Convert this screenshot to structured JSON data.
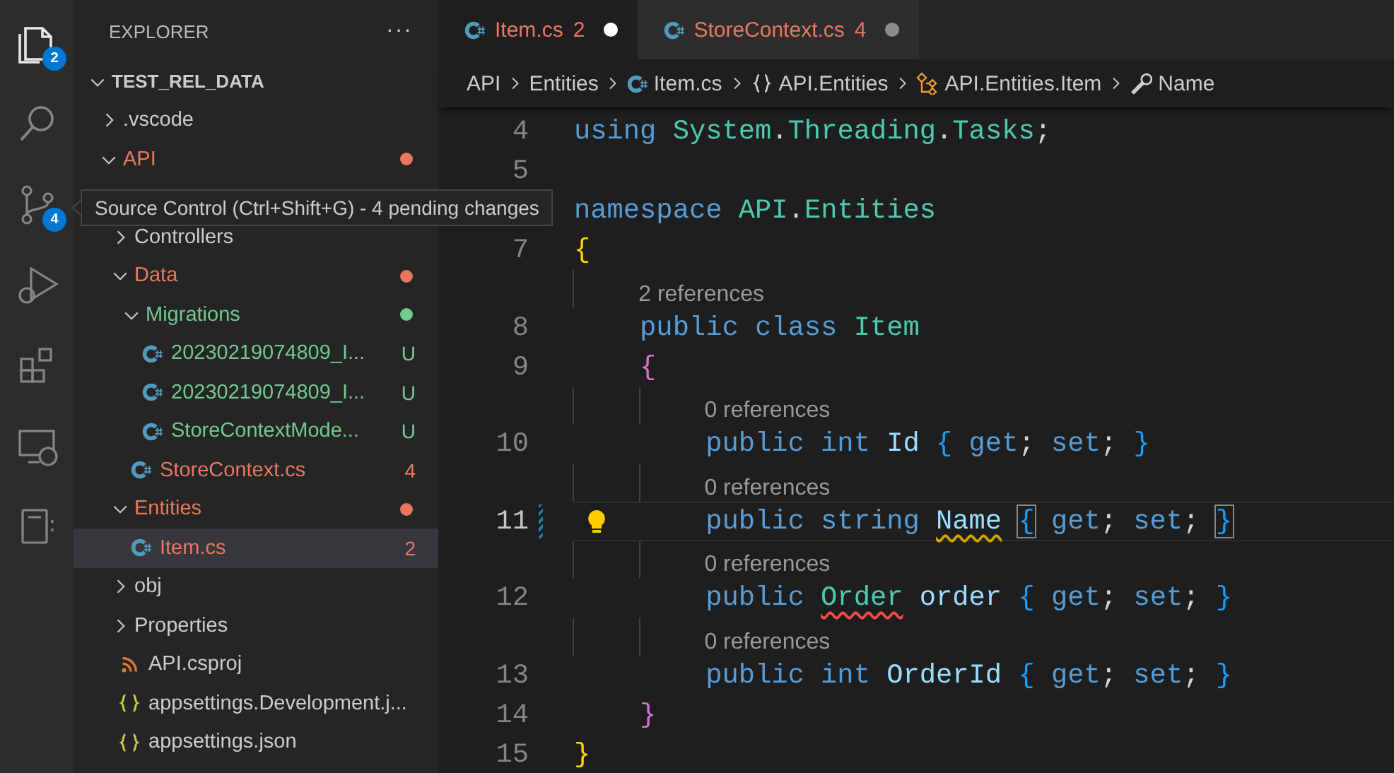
{
  "activity_bar": [
    {
      "selected": true,
      "badge": "2"
    },
    {
      "selected": false
    },
    {
      "selected": false,
      "badge": "4"
    },
    {
      "selected": false
    },
    {
      "selected": false
    },
    {
      "selected": false
    },
    {
      "selected": false
    }
  ],
  "tooltip": {
    "text": "Source Control (Ctrl+Shift+G) - 4 pending changes"
  },
  "sidebar": {
    "title": "EXPLORER",
    "more": "···",
    "tree": [
      {
        "label": "TEST_REL_DATA",
        "kind": "root",
        "expanded": true,
        "selected": false,
        "color": "#cccccc",
        "children": [
          {
            "label": ".vscode",
            "kind": "folder",
            "expanded": false,
            "selected": false,
            "color": "#cccccc"
          },
          {
            "label": "API",
            "kind": "folder",
            "expanded": true,
            "selected": false,
            "color": "#e8775f",
            "dot": true,
            "children": [
              {
                "kind": "covered"
              },
              {
                "label": "Controllers",
                "kind": "folder",
                "expanded": false,
                "selected": false,
                "color": "#cccccc"
              },
              {
                "label": "Data",
                "kind": "folder",
                "expanded": true,
                "selected": false,
                "color": "#e8775f",
                "dot": true,
                "children": [
                  {
                    "label": "Migrations",
                    "kind": "folder",
                    "expanded": true,
                    "selected": false,
                    "color": "#73c991",
                    "dot": true,
                    "children": [
                      {
                        "label": "20230219074809_I...",
                        "kind": "csharp-file",
                        "color": "#73c991",
                        "badge": "U",
                        "selected": false
                      },
                      {
                        "label": "20230219074809_I...",
                        "kind": "csharp-file",
                        "color": "#73c991",
                        "badge": "U",
                        "selected": false
                      },
                      {
                        "label": "StoreContextMode...",
                        "kind": "csharp-file",
                        "color": "#73c991",
                        "badge": "U",
                        "selected": false
                      }
                    ]
                  },
                  {
                    "label": "StoreContext.cs",
                    "kind": "csharp-file",
                    "color": "#e8775f",
                    "badge": "4",
                    "selected": false
                  }
                ]
              },
              {
                "label": "Entities",
                "kind": "folder",
                "expanded": true,
                "selected": false,
                "color": "#e8775f",
                "dot": true,
                "children": [
                  {
                    "label": "Item.cs",
                    "kind": "csharp-file",
                    "color": "#e8775f",
                    "badge": "2",
                    "selected": true
                  }
                ]
              },
              {
                "label": "obj",
                "kind": "folder",
                "expanded": false,
                "selected": false,
                "color": "#cccccc"
              },
              {
                "label": "Properties",
                "kind": "folder",
                "expanded": false,
                "selected": false,
                "color": "#cccccc"
              },
              {
                "label": "API.csproj",
                "kind": "rss-file",
                "selected": false,
                "color": "#cccccc"
              },
              {
                "label": "appsettings.Development.j...",
                "kind": "json-file",
                "selected": false,
                "color": "#cccccc"
              },
              {
                "label": "appsettings.json",
                "kind": "json-file",
                "selected": false,
                "color": "#cccccc"
              }
            ]
          }
        ]
      }
    ]
  },
  "tabs": [
    {
      "label": "Item.cs",
      "badge": "2",
      "selected": true,
      "dirty": true
    },
    {
      "label": "StoreContext.cs",
      "badge": "4",
      "selected": false,
      "dirty": true
    }
  ],
  "breadcrumbs": [
    {
      "label": "API",
      "kind": "folder"
    },
    {
      "label": "Entities",
      "kind": "folder"
    },
    {
      "label": "Item.cs",
      "kind": "csharp-file"
    },
    {
      "label": "API.Entities",
      "kind": "namespace"
    },
    {
      "label": "API.Entities.Item",
      "kind": "class"
    },
    {
      "label": "Name",
      "kind": "property"
    }
  ],
  "code": [
    {
      "number": "4",
      "current": false,
      "tokens": [
        {
          "kind": "kw",
          "text": "using "
        },
        {
          "kind": "ty",
          "text": "System"
        },
        {
          "kind": "p",
          "text": "."
        },
        {
          "kind": "ty",
          "text": "Threading"
        },
        {
          "kind": "p",
          "text": "."
        },
        {
          "kind": "ty",
          "text": "Tasks"
        },
        {
          "kind": "p",
          "text": ";"
        }
      ]
    },
    {
      "number": "5",
      "current": false
    },
    {
      "tokens": [
        {
          "kind": "kw",
          "text": "namespace "
        },
        {
          "kind": "ty",
          "text": "API"
        },
        {
          "kind": "p",
          "text": "."
        },
        {
          "kind": "ty",
          "text": "Entities"
        }
      ]
    },
    {
      "number": "7",
      "current": false,
      "tokens": [
        {
          "kind": "b1",
          "text": "{"
        }
      ]
    },
    {
      "number": "8",
      "current": false,
      "lens": "2 references",
      "tokens": [
        {
          "kind": "kw",
          "text": "    public class "
        },
        {
          "kind": "ty",
          "text": "Item"
        }
      ]
    },
    {
      "number": "9",
      "current": false,
      "tokens": [
        {
          "kind": "b2",
          "text": "    {"
        }
      ]
    },
    {
      "number": "10",
      "current": false,
      "lens": "0 references",
      "tokens": [
        {
          "kind": "kw",
          "text": "        public int "
        },
        {
          "kind": "id",
          "text": "Id "
        },
        {
          "kind": "b3",
          "text": "{ "
        },
        {
          "kind": "kw",
          "text": "get"
        },
        {
          "kind": "p",
          "text": "; "
        },
        {
          "kind": "kw",
          "text": "set"
        },
        {
          "kind": "p",
          "text": "; "
        },
        {
          "kind": "b3",
          "text": "}"
        }
      ]
    },
    {
      "number": "11",
      "current": true,
      "lens": "0 references",
      "tokens": [
        {
          "kind": "kw",
          "text": "        public string "
        },
        {
          "kind": "id",
          "text": "Name ",
          "warning": true
        },
        {
          "kind": "b3",
          "text": "{",
          "matched": true
        },
        {
          "kind": "kw",
          "text": " get"
        },
        {
          "kind": "p",
          "text": "; "
        },
        {
          "kind": "kw",
          "text": "set"
        },
        {
          "kind": "p",
          "text": "; "
        },
        {
          "kind": "b3",
          "text": "}",
          "matched": true
        }
      ]
    },
    {
      "number": "12",
      "current": false,
      "lens": "0 references",
      "tokens": [
        {
          "kind": "kw",
          "text": "        public "
        },
        {
          "kind": "ty",
          "text": "Order",
          "error": true
        },
        {
          "kind": "id",
          "text": " order "
        },
        {
          "kind": "b3",
          "text": "{ "
        },
        {
          "kind": "kw",
          "text": "get"
        },
        {
          "kind": "p",
          "text": "; "
        },
        {
          "kind": "kw",
          "text": "set"
        },
        {
          "kind": "p",
          "text": "; "
        },
        {
          "kind": "b3",
          "text": "}"
        }
      ]
    },
    {
      "number": "13",
      "current": false,
      "lens": "0 references",
      "tokens": [
        {
          "kind": "kw",
          "text": "        public int "
        },
        {
          "kind": "id",
          "text": "OrderId "
        },
        {
          "kind": "b3",
          "text": "{ "
        },
        {
          "kind": "kw",
          "text": "get"
        },
        {
          "kind": "p",
          "text": "; "
        },
        {
          "kind": "kw",
          "text": "set"
        },
        {
          "kind": "p",
          "text": "; "
        },
        {
          "kind": "b3",
          "text": "}"
        }
      ]
    },
    {
      "number": "14",
      "current": false,
      "tokens": [
        {
          "kind": "b2",
          "text": "    }"
        }
      ]
    },
    {
      "number": "15",
      "current": false,
      "tokens": [
        {
          "kind": "b1",
          "text": "}"
        }
      ]
    }
  ]
}
